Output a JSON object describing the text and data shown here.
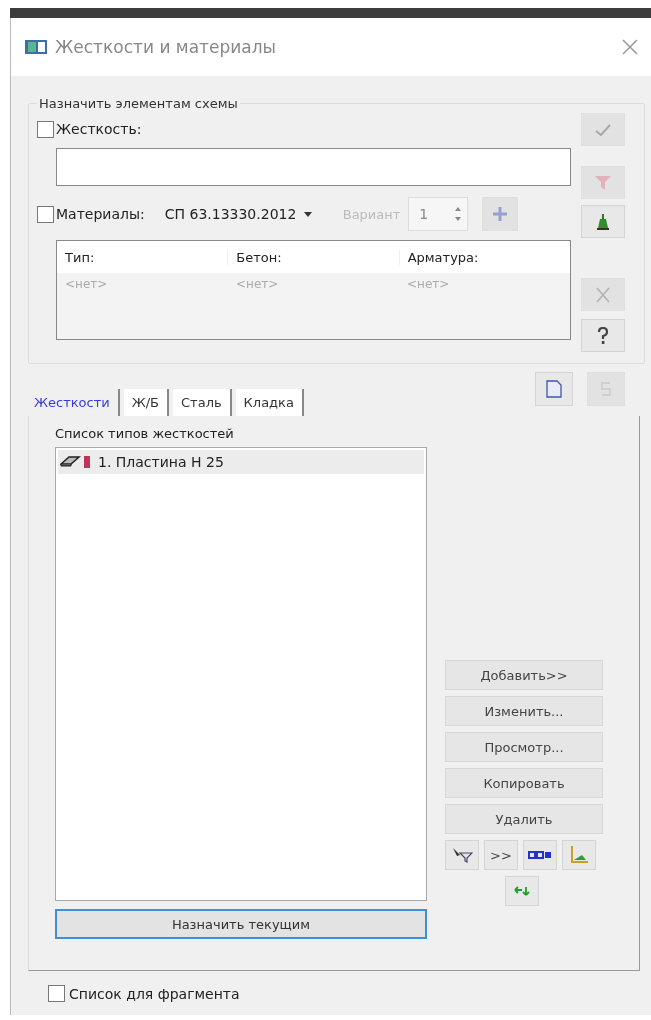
{
  "window": {
    "title": "Жесткости и материалы"
  },
  "assign_group": {
    "title": "Назначить элементам схемы",
    "stiffness": {
      "label": "Жесткость:",
      "checked": false
    },
    "materials": {
      "label": "Материалы:",
      "checked": false,
      "norm": "СП 63.13330.2012",
      "variant_label": "Вариант",
      "variant": "1",
      "variant_disabled": true
    },
    "table": {
      "columns": [
        "Тип:",
        "Бетон:",
        "Арматура:"
      ],
      "rows": [
        [
          "<нет>",
          "<нет>",
          "<нет>"
        ]
      ]
    },
    "add_material_disabled": true,
    "tool_buttons": [
      {
        "kind": "check",
        "disabled": true
      },
      {
        "kind": "filter",
        "disabled": true
      },
      {
        "kind": "flag",
        "disabled": false
      },
      {
        "kind": "scissors",
        "disabled": true
      },
      {
        "kind": "help",
        "disabled": false
      }
    ]
  },
  "top_tools": [
    {
      "kind": "document",
      "disabled": false
    },
    {
      "kind": "s",
      "disabled": true
    }
  ],
  "tabs": [
    {
      "label": "Жесткости",
      "selected": true
    },
    {
      "label": "Ж/Б",
      "selected": false
    },
    {
      "label": "Сталь",
      "selected": false
    },
    {
      "label": "Кладка",
      "selected": false
    }
  ],
  "list": {
    "title": "Список типов жесткостей",
    "items": [
      {
        "label": "1. Пластина  H 25",
        "selected": true
      }
    ]
  },
  "actions": [
    "Добавить>>",
    "Изменить...",
    "Просмотр...",
    "Копировать",
    "Удалить"
  ],
  "small_tools": [
    {
      "kind": "pointer"
    },
    {
      "kind": "text",
      "label": ">>"
    },
    {
      "kind": "dimensions"
    },
    {
      "kind": "axes"
    },
    {
      "kind": "refresh"
    }
  ],
  "assign_button": {
    "label": "Назначить текущим",
    "focused": true
  },
  "fragment": {
    "label": "Список для фрагмента",
    "checked": false
  }
}
